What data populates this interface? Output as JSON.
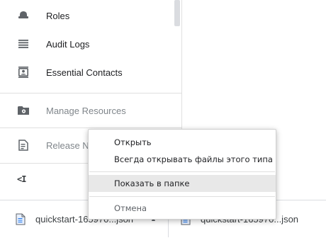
{
  "sidebar": {
    "items": [
      {
        "label": "Roles",
        "icon": "hat-icon"
      },
      {
        "label": "Audit Logs",
        "icon": "list-lines-icon"
      },
      {
        "label": "Essential Contacts",
        "icon": "contact-card-icon"
      },
      {
        "label": "Manage Resources",
        "icon": "folder-gear-icon"
      },
      {
        "label": "Release Notes",
        "icon": "release-notes-icon"
      }
    ],
    "collapse_label": "<I"
  },
  "context_menu": {
    "items": [
      {
        "label": "Открыть"
      },
      {
        "label": "Всегда открывать файлы этого типа"
      },
      {
        "label": "Показать в папке"
      },
      {
        "label": "Отмена"
      }
    ]
  },
  "download_bar": {
    "items": [
      {
        "file_name": "quickstart-165970...json"
      },
      {
        "file_name": "quickstart-165970...json"
      }
    ]
  },
  "colors": {
    "highlight": "#e8e8e8",
    "text": "#202124",
    "muted_text": "#80868b",
    "divider": "#e0e0e0"
  }
}
